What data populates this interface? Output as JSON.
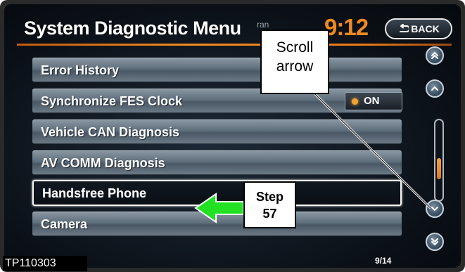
{
  "header": {
    "title": "System Diagnostic Menu",
    "title_suffix": "ran",
    "clock": "9:12",
    "back_label": "BACK"
  },
  "menu": {
    "items": [
      {
        "label": "Error History"
      },
      {
        "label": "Synchronize FES Clock",
        "toggle": "ON"
      },
      {
        "label": "Vehicle CAN Diagnosis"
      },
      {
        "label": "AV COMM Diagnosis"
      },
      {
        "label": "Handsfree Phone",
        "selected": true
      },
      {
        "label": "Camera"
      }
    ]
  },
  "scroll": {
    "page_counter": "9/14",
    "position_fraction": 0.64
  },
  "annotations": {
    "scroll_callout_line1": "Scroll",
    "scroll_callout_line2": "arrow",
    "step_line1": "Step",
    "step_line2": "57",
    "figure_id": "TP110303"
  },
  "colors": {
    "accent_orange": "#f08a1e",
    "arrow_green": "#22e022"
  }
}
